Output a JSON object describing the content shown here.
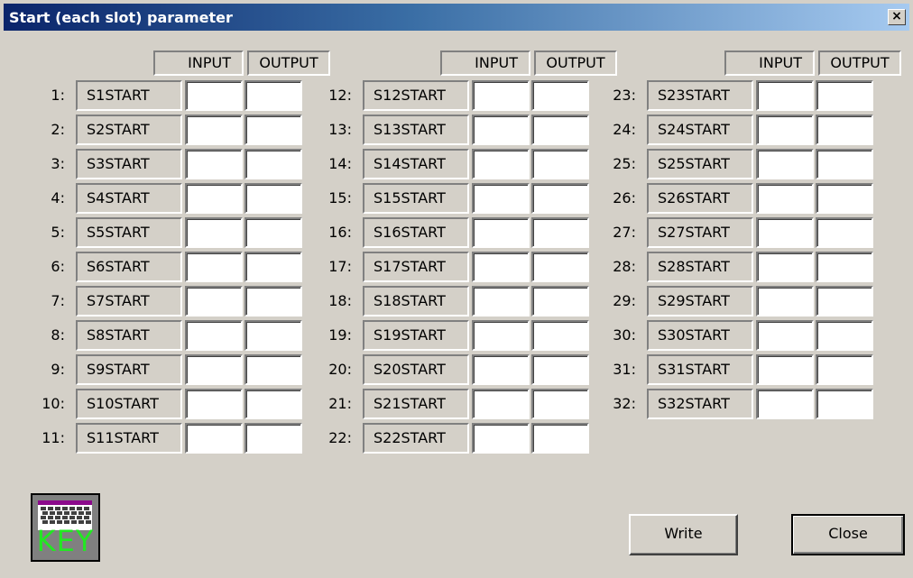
{
  "window": {
    "title": "Start (each slot) parameter",
    "close_glyph": "×"
  },
  "headers": {
    "input": "INPUT",
    "output": "OUTPUT"
  },
  "columns": [
    {
      "slots": [
        {
          "num": "1:",
          "label": "S1START",
          "input": "",
          "output": ""
        },
        {
          "num": "2:",
          "label": "S2START",
          "input": "",
          "output": ""
        },
        {
          "num": "3:",
          "label": "S3START",
          "input": "",
          "output": ""
        },
        {
          "num": "4:",
          "label": "S4START",
          "input": "",
          "output": ""
        },
        {
          "num": "5:",
          "label": "S5START",
          "input": "",
          "output": ""
        },
        {
          "num": "6:",
          "label": "S6START",
          "input": "",
          "output": ""
        },
        {
          "num": "7:",
          "label": "S7START",
          "input": "",
          "output": ""
        },
        {
          "num": "8:",
          "label": "S8START",
          "input": "",
          "output": ""
        },
        {
          "num": "9:",
          "label": "S9START",
          "input": "",
          "output": ""
        },
        {
          "num": "10:",
          "label": "S10START",
          "input": "",
          "output": ""
        },
        {
          "num": "11:",
          "label": "S11START",
          "input": "",
          "output": ""
        }
      ]
    },
    {
      "slots": [
        {
          "num": "12:",
          "label": "S12START",
          "input": "",
          "output": ""
        },
        {
          "num": "13:",
          "label": "S13START",
          "input": "",
          "output": ""
        },
        {
          "num": "14:",
          "label": "S14START",
          "input": "",
          "output": ""
        },
        {
          "num": "15:",
          "label": "S15START",
          "input": "",
          "output": ""
        },
        {
          "num": "16:",
          "label": "S16START",
          "input": "",
          "output": ""
        },
        {
          "num": "17:",
          "label": "S17START",
          "input": "",
          "output": ""
        },
        {
          "num": "18:",
          "label": "S18START",
          "input": "",
          "output": ""
        },
        {
          "num": "19:",
          "label": "S19START",
          "input": "",
          "output": ""
        },
        {
          "num": "20:",
          "label": "S20START",
          "input": "",
          "output": ""
        },
        {
          "num": "21:",
          "label": "S21START",
          "input": "",
          "output": ""
        },
        {
          "num": "22:",
          "label": "S22START",
          "input": "",
          "output": ""
        }
      ]
    },
    {
      "slots": [
        {
          "num": "23:",
          "label": "S23START",
          "input": "",
          "output": ""
        },
        {
          "num": "24:",
          "label": "S24START",
          "input": "",
          "output": ""
        },
        {
          "num": "25:",
          "label": "S25START",
          "input": "",
          "output": ""
        },
        {
          "num": "26:",
          "label": "S26START",
          "input": "",
          "output": ""
        },
        {
          "num": "27:",
          "label": "S27START",
          "input": "",
          "output": ""
        },
        {
          "num": "28:",
          "label": "S28START",
          "input": "",
          "output": ""
        },
        {
          "num": "29:",
          "label": "S29START",
          "input": "",
          "output": ""
        },
        {
          "num": "30:",
          "label": "S30START",
          "input": "",
          "output": ""
        },
        {
          "num": "31:",
          "label": "S31START",
          "input": "",
          "output": ""
        },
        {
          "num": "32:",
          "label": "S32START",
          "input": "",
          "output": ""
        }
      ]
    }
  ],
  "key_button": {
    "label": "KEY",
    "icon": "keyboard-icon"
  },
  "buttons": {
    "write": "Write",
    "close": "Close"
  },
  "colors": {
    "title_start": "#0a246a",
    "title_end": "#a6caf0",
    "face": "#d4d0c8",
    "key_text": "#22e822",
    "keyboard_bar": "#8b0a8b"
  }
}
